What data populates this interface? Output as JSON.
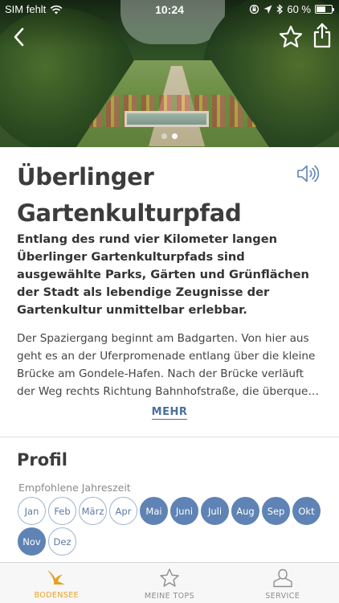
{
  "status_bar": {
    "carrier": "SIM fehlt",
    "time": "10:24",
    "battery_text": "60 %",
    "battery_level": 0.6
  },
  "hero": {
    "image_count": 2,
    "active_index": 1
  },
  "poi": {
    "title": "Überlinger Gartenkulturpfad",
    "lead": "Entlang des rund vier Kilometer langen Überlinger Gartenkulturpfads sind ausgewählte Parks, Gärten und Grünflächen der Stadt als lebendige Zeugnisse der Gartenkultur unmittelbar erlebbar.",
    "body": "Der Spaziergang beginnt am Badgarten. Von hier aus geht es an der Uferpromenade entlang über die kleine Brücke am Gondele-Hafen. Nach der Brücke verläuft der Weg rechts Richtung Bahnhofstraße, die überque…",
    "more_label": "MEHR"
  },
  "profile": {
    "title": "Profil",
    "season_label": "Empfohlene Jahreszeit",
    "months": [
      {
        "label": "Jan",
        "recommended": false
      },
      {
        "label": "Feb",
        "recommended": false
      },
      {
        "label": "März",
        "recommended": false
      },
      {
        "label": "Apr",
        "recommended": false
      },
      {
        "label": "Mai",
        "recommended": true
      },
      {
        "label": "Juni",
        "recommended": true
      },
      {
        "label": "Juli",
        "recommended": true
      },
      {
        "label": "Aug",
        "recommended": true
      },
      {
        "label": "Sep",
        "recommended": true
      },
      {
        "label": "Okt",
        "recommended": true
      },
      {
        "label": "Nov",
        "recommended": true
      },
      {
        "label": "Dez",
        "recommended": false
      }
    ]
  },
  "tabbar": {
    "tabs": [
      {
        "label": "BODENSEE",
        "icon": "bodensee-logo-icon",
        "active": true
      },
      {
        "label": "MEINE TOPS",
        "icon": "star-outline-icon",
        "active": false
      },
      {
        "label": "SERVICE",
        "icon": "person-icon",
        "active": false
      }
    ]
  },
  "colors": {
    "accent_blue": "#5f83b4",
    "link_blue": "#4a6f9c",
    "active_tab": "#e8a020"
  }
}
